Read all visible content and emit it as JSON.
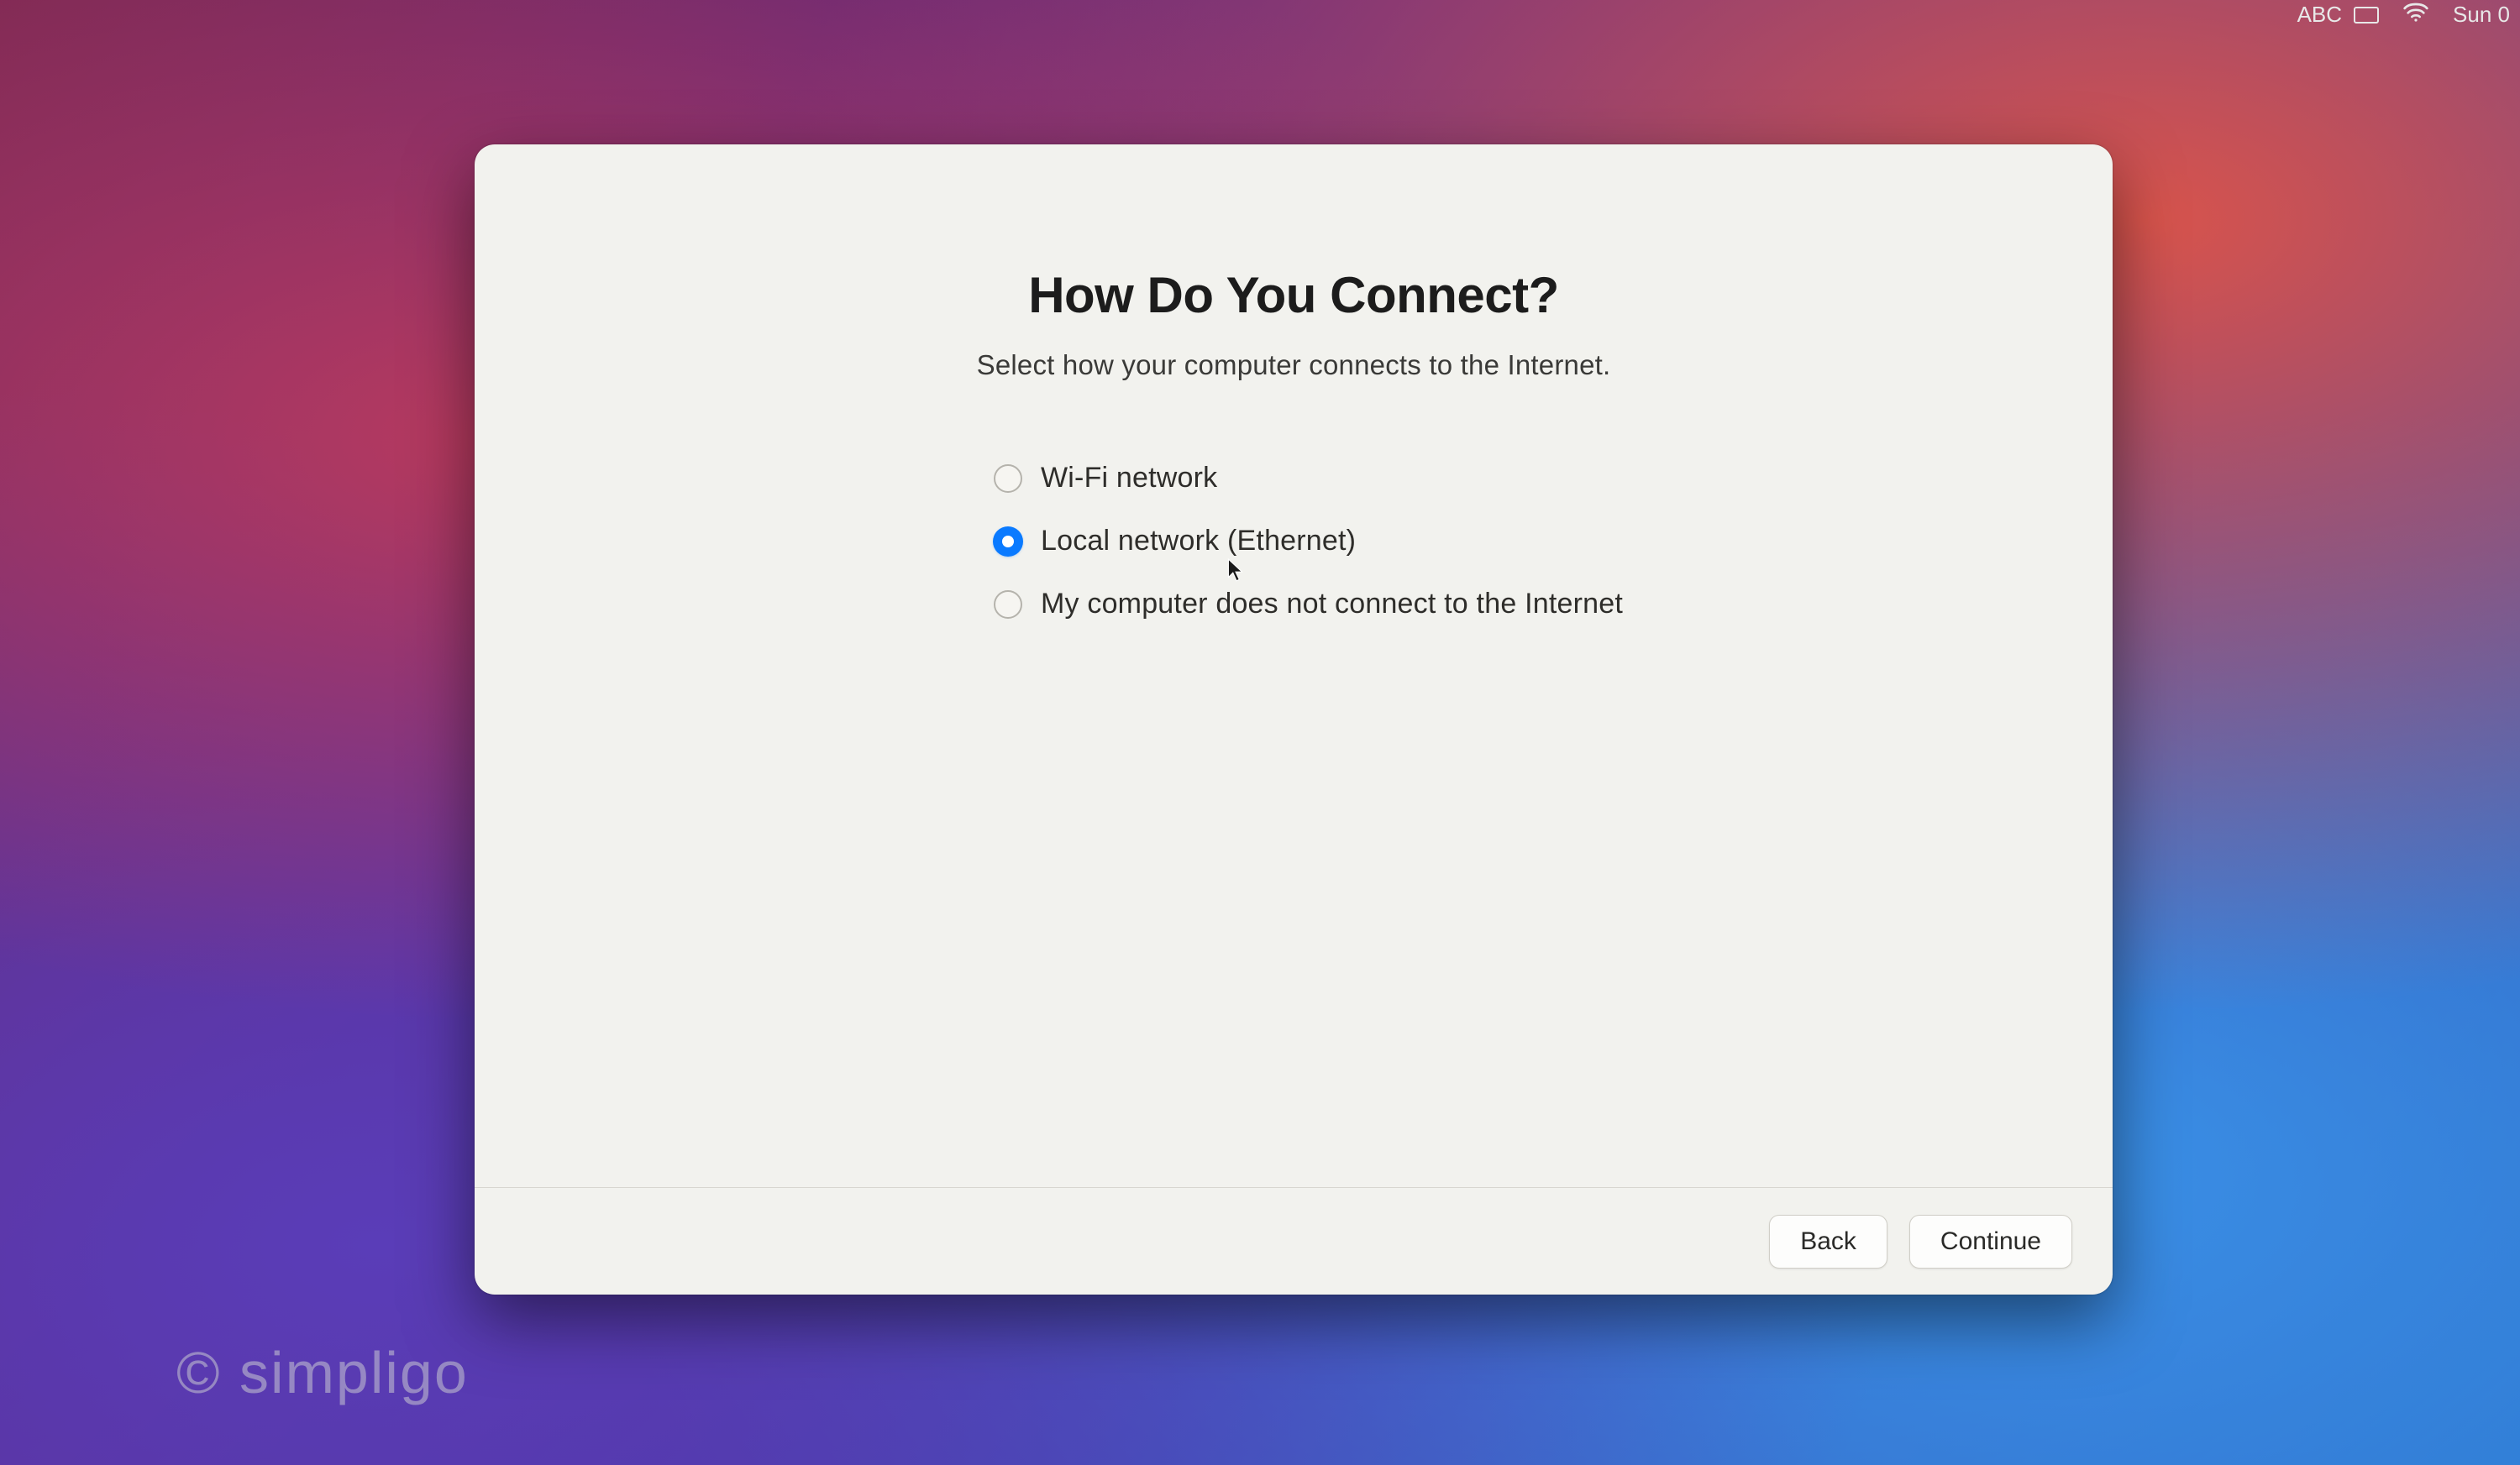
{
  "menubar": {
    "input_indicator": "ABC",
    "date_time": "Sun 0"
  },
  "dialog": {
    "title": "How Do You Connect?",
    "subtitle": "Select how your computer connects to the Internet.",
    "options": [
      {
        "label": "Wi-Fi network",
        "selected": false
      },
      {
        "label": "Local network (Ethernet)",
        "selected": true
      },
      {
        "label": "My computer does not connect to the Internet",
        "selected": false
      }
    ],
    "buttons": {
      "back": "Back",
      "continue": "Continue"
    }
  },
  "watermark": "© simpligo"
}
